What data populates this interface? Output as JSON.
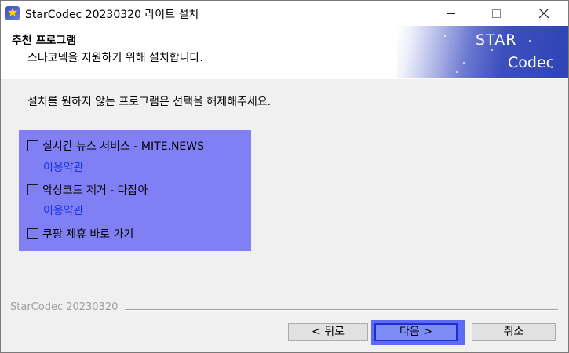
{
  "window": {
    "title": "StarCodec 20230320 라이트 설치"
  },
  "header": {
    "title": "추천 프로그램",
    "subtitle": "스타코덱을 지원하기 위해 설치합니다.",
    "logo_line1": "STAR",
    "logo_line2": "Codec"
  },
  "main": {
    "instruction": "설치를 원하지 않는 프로그램은 선택을 해제해주세요.",
    "options": [
      {
        "label": "실시간 뉴스 서비스 - MITE.NEWS",
        "checked": false,
        "link": "이용약관"
      },
      {
        "label": "악성코드 제거 - 다잡아",
        "checked": false,
        "link": "이용약관"
      },
      {
        "label": "쿠팡 제휴 바로 가기",
        "checked": false
      }
    ],
    "panel_color": "#8080f4",
    "link_color": "#1633e8"
  },
  "footer": {
    "brand": "StarCodec 20230320",
    "back_label": "< 뒤로",
    "next_label": "다음 >",
    "cancel_label": "취소"
  }
}
